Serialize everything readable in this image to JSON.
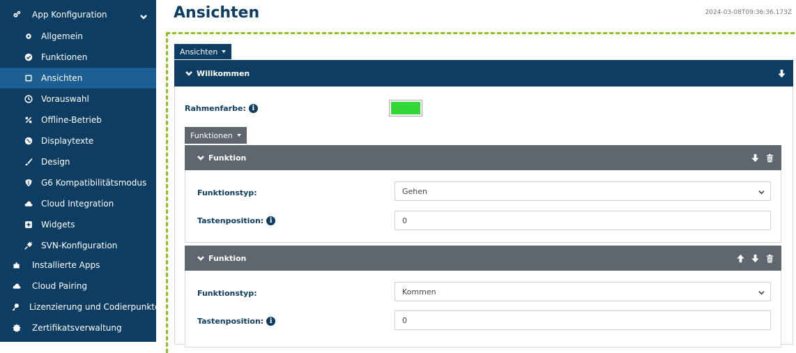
{
  "sidebar": {
    "header": "App Konfiguration",
    "items": [
      {
        "label": "Allgemein",
        "icon": "gear-icon"
      },
      {
        "label": "Funktionen",
        "icon": "check-circle-icon"
      },
      {
        "label": "Ansichten",
        "icon": "square-icon"
      },
      {
        "label": "Vorauswahl",
        "icon": "clock-icon"
      },
      {
        "label": "Offline-Betrieb",
        "icon": "percent-icon"
      },
      {
        "label": "Displaytexte",
        "icon": "globe-icon"
      },
      {
        "label": "Design",
        "icon": "brush-icon"
      },
      {
        "label": "G6 Kompatibilitätsmodus",
        "icon": "shield-icon"
      },
      {
        "label": "Cloud Integration",
        "icon": "cloud-icon"
      },
      {
        "label": "Widgets",
        "icon": "plus-square-icon"
      },
      {
        "label": "SVN-Konfiguration",
        "icon": "plug-icon"
      }
    ],
    "top_items": [
      {
        "label": "Installierte Apps",
        "icon": "puzzle-icon"
      },
      {
        "label": "Cloud Pairing",
        "icon": "cloud-icon"
      },
      {
        "label": "Lizenzierung und Codierpunkte",
        "icon": "key-icon"
      },
      {
        "label": "Zertifikatsverwaltung",
        "icon": "badge-icon"
      }
    ]
  },
  "main": {
    "title": "Ansichten",
    "timestamp": "2024-03-08T09:36:36.173Z",
    "views_button": "Ansichten",
    "section_title": "Willkommen",
    "frame_color_label": "Rahmenfarbe:",
    "frame_color": "#32d936",
    "functions_button": "Funktionen",
    "functions": [
      {
        "title": "Funktion",
        "type_label": "Funktionstyp:",
        "type_value": "Gehen",
        "pos_label": "Tastenposition:",
        "pos_value": "0"
      },
      {
        "title": "Funktion",
        "type_label": "Funktionstyp:",
        "type_value": "Kommen",
        "pos_label": "Tastenposition:",
        "pos_value": "0"
      }
    ]
  },
  "colors": {
    "sidebar_bg": "#0e3d63",
    "sidebar_active": "#1d5e93",
    "bar_grey": "#5f6670",
    "dashed_border": "#8fbf23"
  }
}
